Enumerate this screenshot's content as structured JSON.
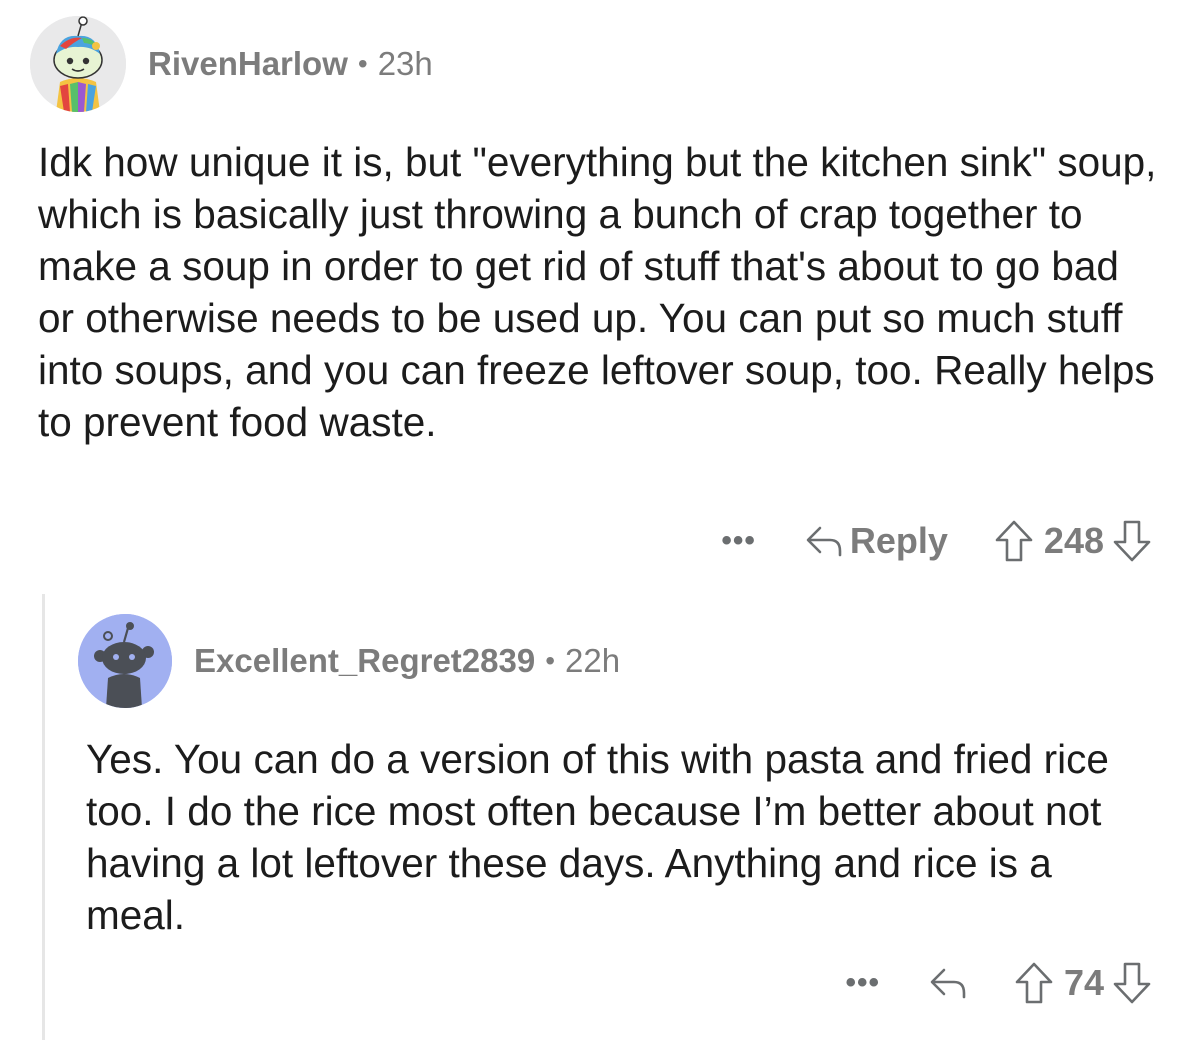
{
  "comment": {
    "username": "RivenHarlow",
    "separator": "•",
    "time": "23h",
    "body": "Idk how unique it is, but \"everything but the kitchen sink\" soup, which is basically just throwing a bunch of crap together to make a soup in order to get rid of stuff that's about to go bad or otherwise needs to be used up. You can put so much stuff into soups, and you can freeze leftover soup, too. Really helps to prevent food waste.",
    "more_label": "•••",
    "reply_label": "Reply",
    "score": "248",
    "icons": {
      "more": "more-options-icon",
      "reply": "reply-arrow-icon",
      "upvote": "upvote-arrow-icon",
      "downvote": "downvote-arrow-icon"
    }
  },
  "reply": {
    "username": "Excellent_Regret2839",
    "separator": "•",
    "time": "22h",
    "body": "Yes. You can do a version of this with pasta and fried rice too. I do the rice most often because I’m better about not having a lot leftover these days. Anything and rice is a meal.",
    "more_label": "•••",
    "score": "74",
    "avatar_color": "#a1b0f1",
    "icons": {
      "more": "more-options-icon",
      "reply": "reply-arrow-icon",
      "upvote": "upvote-arrow-icon",
      "downvote": "downvote-arrow-icon"
    }
  }
}
